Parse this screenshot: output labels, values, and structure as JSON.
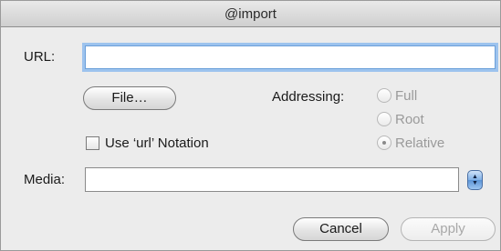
{
  "window": {
    "title": "@import"
  },
  "url": {
    "label": "URL:",
    "value": "",
    "placeholder": ""
  },
  "file_button": {
    "label": "File…"
  },
  "addressing": {
    "label": "Addressing:",
    "options": [
      {
        "label": "Full",
        "selected": false
      },
      {
        "label": "Root",
        "selected": false
      },
      {
        "label": "Relative",
        "selected": true
      }
    ],
    "enabled": false
  },
  "url_notation": {
    "label": "Use ‘url’ Notation",
    "checked": false
  },
  "media": {
    "label": "Media:",
    "value": "",
    "stepper_icon": "up-down-arrows-icon"
  },
  "actions": {
    "cancel_label": "Cancel",
    "apply_label": "Apply",
    "apply_enabled": false
  },
  "colors": {
    "focus_ring": "#9dc3ee",
    "stepper_blue": "#5b93d6"
  }
}
